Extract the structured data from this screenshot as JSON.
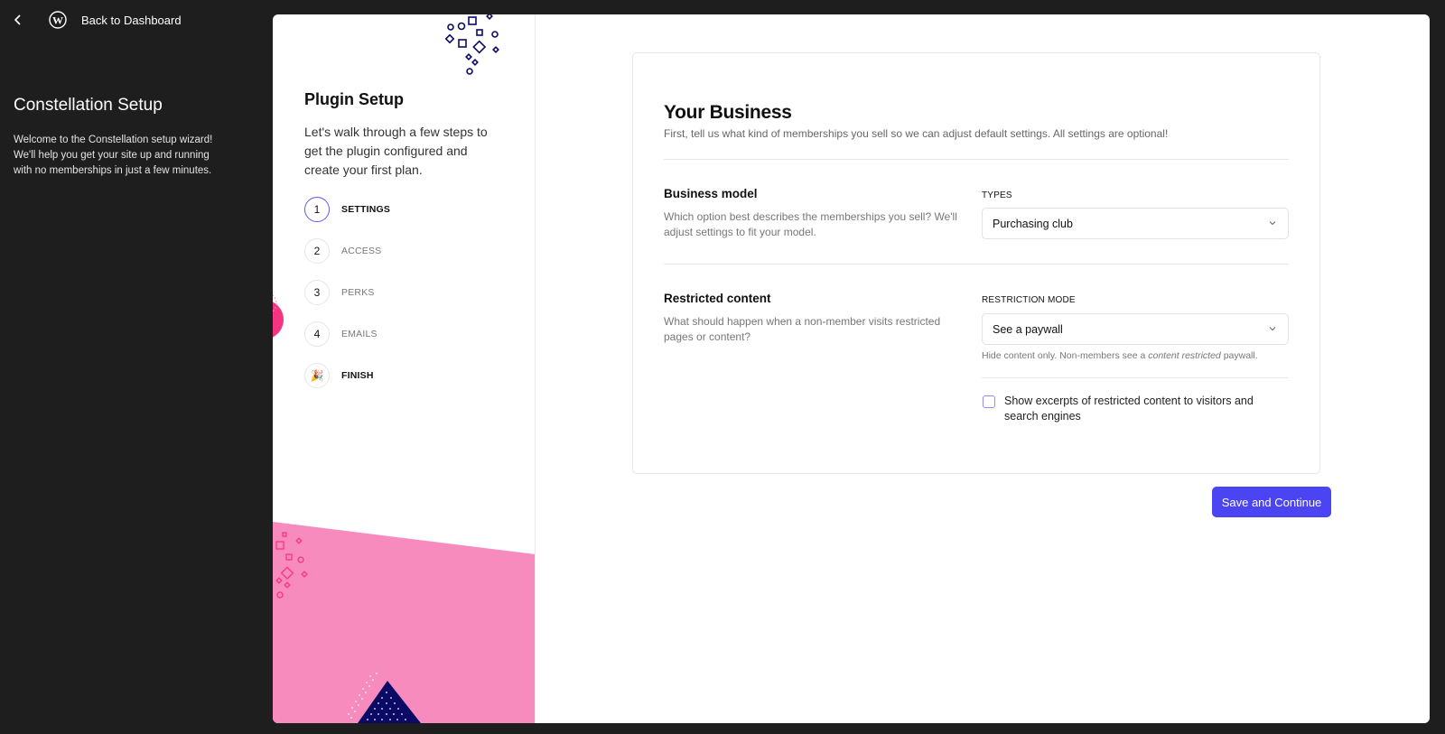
{
  "sidebar": {
    "back_label": "Back to Dashboard",
    "title": "Constellation Setup",
    "description": "Welcome to the Constellation setup wizard! We'll help you get your site up and running with no memberships in just a few minutes."
  },
  "wizard": {
    "title": "Plugin Setup",
    "intro": "Let's walk through a few steps to get the plugin configured and create your first plan.",
    "steps": [
      {
        "number": "1",
        "label": "SETTINGS",
        "state": "active"
      },
      {
        "number": "2",
        "label": "ACCESS",
        "state": "pending"
      },
      {
        "number": "3",
        "label": "PERKS",
        "state": "pending"
      },
      {
        "number": "4",
        "label": "EMAILS",
        "state": "pending"
      },
      {
        "number": "🎉",
        "label": "FINISH",
        "state": "finish"
      }
    ]
  },
  "form": {
    "title": "Your Business",
    "subtitle": "First, tell us what kind of memberships you sell so we can adjust default settings. All settings are optional!",
    "business_model": {
      "title": "Business model",
      "description": "Which option best describes the memberships you sell? We'll adjust settings to fit your model.",
      "field_label": "TYPES",
      "value": "Purchasing club"
    },
    "restricted_content": {
      "title": "Restricted content",
      "description": "What should happen when a non-member visits restricted pages or content?",
      "field_label": "RESTRICTION MODE",
      "value": "See a paywall",
      "help_prefix": "Hide content only. Non-members see a ",
      "help_em": "content restricted",
      "help_suffix": " paywall.",
      "checkbox_label": "Show excerpts of restricted content to visitors and search engines",
      "checkbox_checked": false
    },
    "save_label": "Save and Continue"
  },
  "colors": {
    "accent": "#4b44f2",
    "pink": "#f78bbd",
    "hot_pink": "#f53580",
    "navy": "#0b0b66",
    "background": "#1e1e1e"
  }
}
